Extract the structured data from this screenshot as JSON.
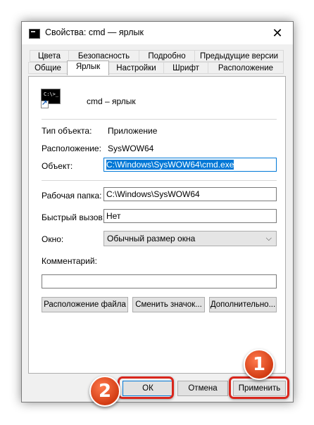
{
  "window": {
    "title": "Свойства: cmd — ярлык",
    "close_glyph": "✕"
  },
  "tabs": {
    "row1": [
      "Цвета",
      "Безопасность",
      "Подробно",
      "Предыдущие версии"
    ],
    "row2": [
      "Общие",
      "Ярлык",
      "Настройки",
      "Шрифт",
      "Расположение"
    ],
    "active": "Ярлык"
  },
  "shortcut": {
    "name": "cmd – ярлык",
    "icon_prompt": "C:\\>_"
  },
  "info": {
    "type_label": "Тип объекта:",
    "type_value": "Приложение",
    "location_label": "Расположение:",
    "location_value": "SysWOW64",
    "target_label": "Объект:",
    "target_value": "C:\\Windows\\SysWOW64\\cmd.exe"
  },
  "settings": {
    "workdir_label": "Рабочая папка:",
    "workdir_value": "C:\\Windows\\SysWOW64",
    "hotkey_label": "Быстрый вызов:",
    "hotkey_value": "Нет",
    "window_label": "Окно:",
    "window_value": "Обычный размер окна",
    "comment_label": "Комментарий:",
    "comment_value": ""
  },
  "panel_buttons": {
    "open_location": "Расположение файла",
    "change_icon": "Сменить значок...",
    "advanced": "Дополнительно..."
  },
  "dialog_buttons": {
    "ok": "ОК",
    "cancel": "Отмена",
    "apply": "Применить"
  },
  "callouts": {
    "step1": "1",
    "step2": "2"
  },
  "colors": {
    "highlight": "#0078d7",
    "callout_red": "#d9261c"
  }
}
